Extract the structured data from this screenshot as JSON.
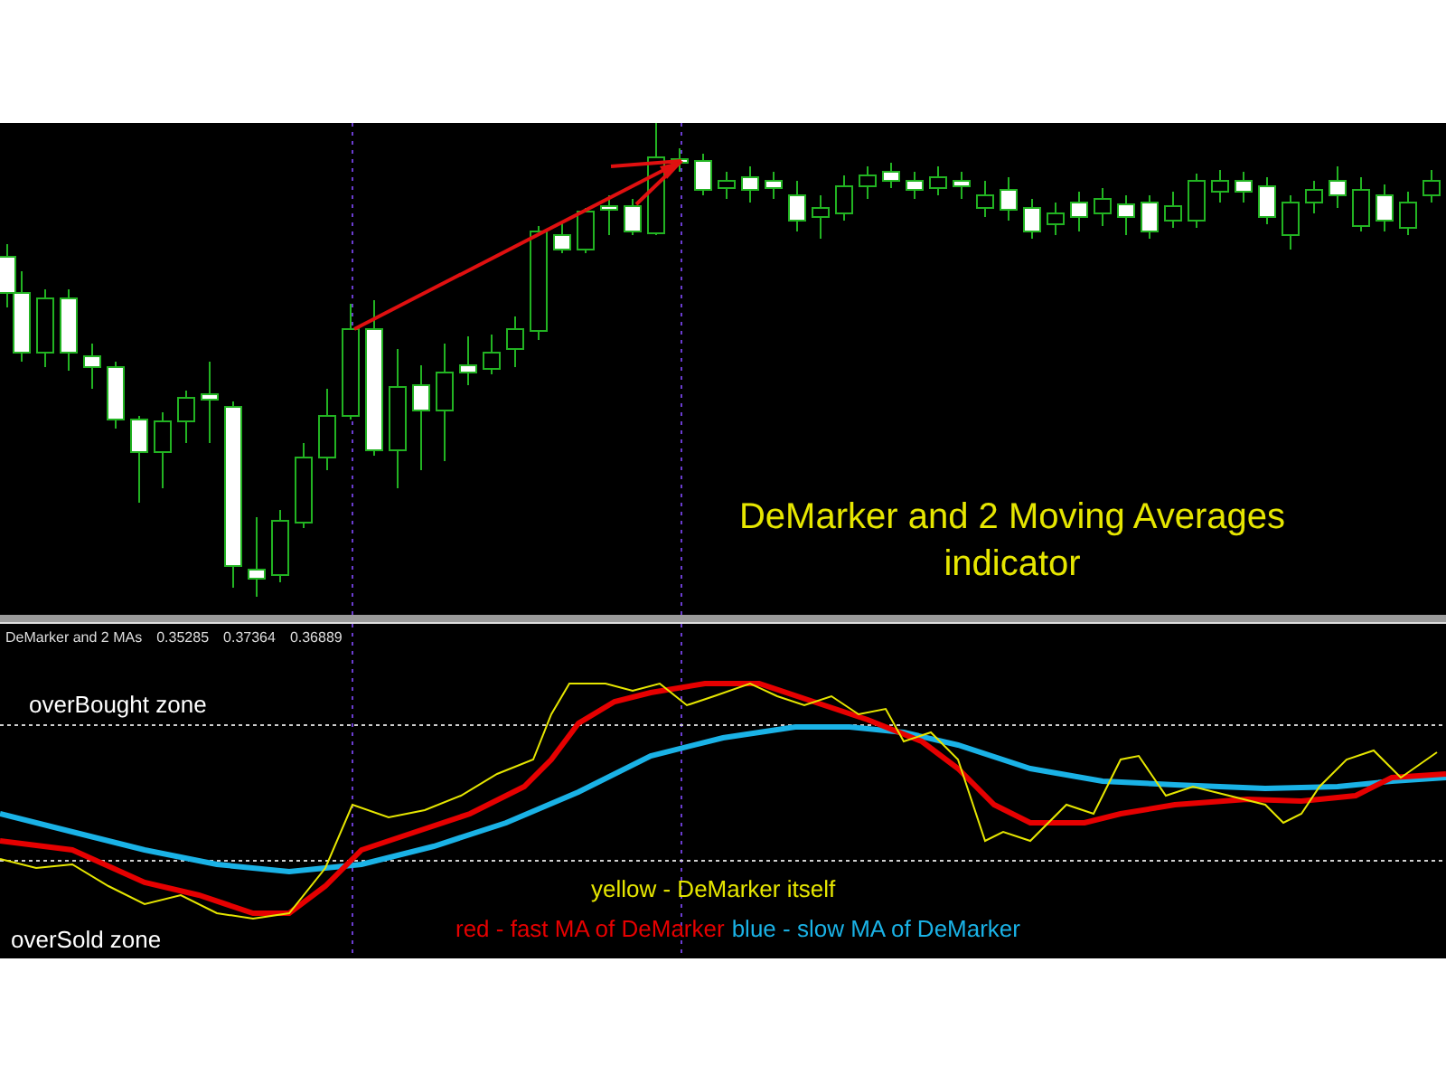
{
  "price_chart": {
    "title": "DeMarker and 2 Moving Averages indicator"
  },
  "indicator_panel": {
    "name": "DeMarker and 2 MAs",
    "values": [
      "0.35285",
      "0.37364",
      "0.36889"
    ],
    "zones": [
      {
        "kind": "overbought",
        "label": "overBought zone"
      },
      {
        "kind": "oversold",
        "label": "overSold zone"
      }
    ],
    "legend_rows": [
      [
        {
          "text": "yellow - DeMarker itself",
          "color": "#e6e600"
        }
      ],
      [
        {
          "text": "red - fast MA of DeMarker",
          "color": "#e60000"
        },
        {
          "text": "blue - slow MA of DeMarker",
          "color": "#1ab2e6"
        }
      ]
    ]
  }
}
